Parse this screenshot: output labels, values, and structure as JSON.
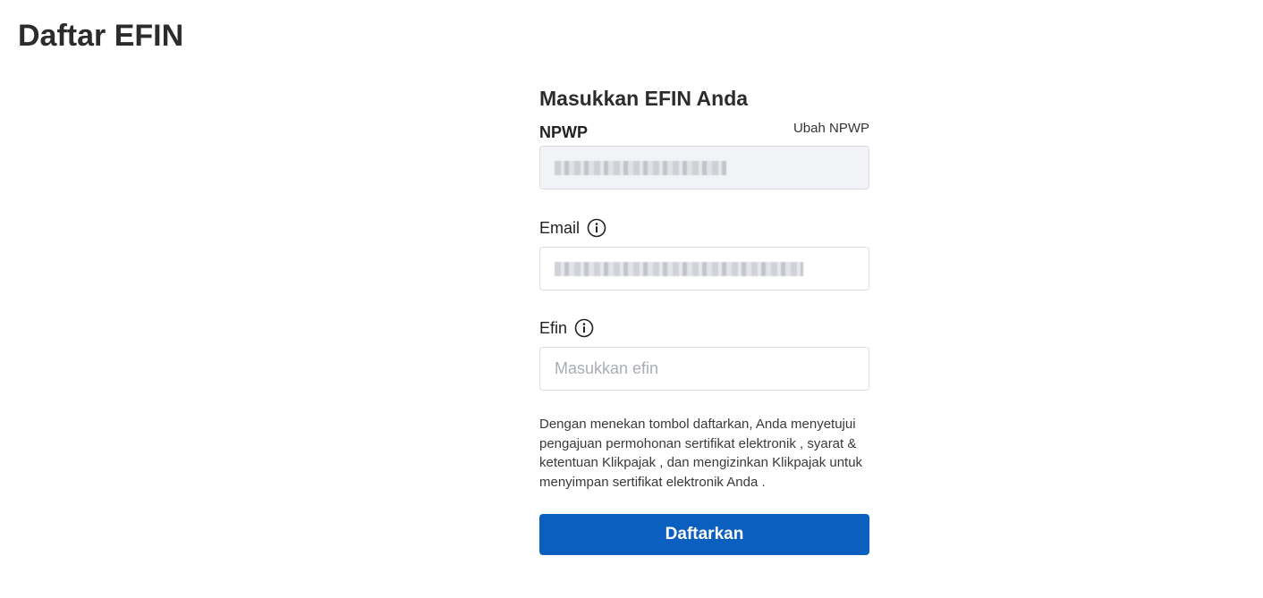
{
  "page": {
    "title": "Daftar EFIN"
  },
  "form": {
    "title": "Masukkan EFIN Anda",
    "npwp": {
      "label": "NPWP",
      "change_link": "Ubah NPWP"
    },
    "email": {
      "label": "Email",
      "info_icon": "info-icon"
    },
    "efin": {
      "label": "Efin",
      "info_icon": "info-icon",
      "placeholder": "Masukkan efin"
    },
    "consent_text": "Dengan menekan tombol daftarkan, Anda menyetujui pengajuan permohonan sertifikat elektronik , syarat & ketentuan Klikpajak , dan mengizinkan Klikpajak untuk menyimpan sertifikat elektronik Anda .",
    "submit_label": "Daftarkan"
  },
  "colors": {
    "primary_button": "#0a5fbf",
    "readonly_field_bg": "#f1f3f7",
    "border": "#d9dde3"
  }
}
